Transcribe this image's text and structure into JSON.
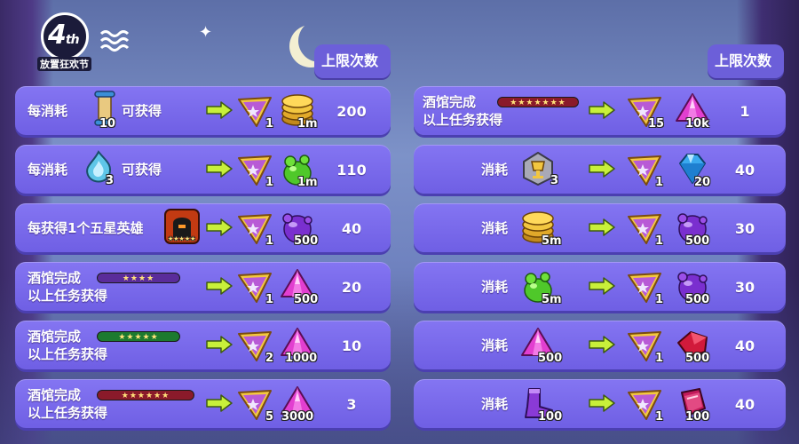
{
  "logo": {
    "main": "4",
    "sup": "th",
    "sub": "放置狂欢节"
  },
  "headers": {
    "left": "上限次数",
    "right": "上限次数"
  },
  "colors": {
    "row_bg": "#7a6aee",
    "header_bg": "#6c5fd9",
    "arrow": "#c8f03a",
    "coin": "#f2c640",
    "gem_pink": "#e23fd0",
    "potion_green": "#52d22a",
    "orb_purple": "#7a2fcf"
  },
  "left_rows": [
    {
      "line1": "每消耗",
      "after": "可获得",
      "cost_icon": "scroll-icon",
      "cost_qty": "10",
      "r1_icon": "ticket-icon",
      "r1_qty": "1",
      "r2_icon": "gold-coin-icon",
      "r2_qty": "1m",
      "limit": "200"
    },
    {
      "line1": "每消耗",
      "after": "可获得",
      "cost_icon": "spirit-flame-icon",
      "cost_qty": "3",
      "r1_icon": "ticket-icon",
      "r1_qty": "1",
      "r2_icon": "green-potion-icon",
      "r2_qty": "1m",
      "limit": "110"
    },
    {
      "line1": "每获得1个五星英雄",
      "cost_icon": "hero-card-icon",
      "cost_qty": "★★★★★",
      "r1_icon": "ticket-icon",
      "r1_qty": "1",
      "r2_icon": "purple-orb-icon",
      "r2_qty": "500",
      "limit": "40"
    },
    {
      "line1": "酒馆完成",
      "line2": "以上任务获得",
      "stars": "★★★★",
      "bar": "purple",
      "r1_icon": "ticket-icon",
      "r1_qty": "1",
      "r2_icon": "pink-gem-icon",
      "r2_qty": "500",
      "limit": "20"
    },
    {
      "line1": "酒馆完成",
      "line2": "以上任务获得",
      "stars": "★★★★★",
      "bar": "green",
      "r1_icon": "ticket-icon",
      "r1_qty": "2",
      "r2_icon": "pink-gem-icon",
      "r2_qty": "1000",
      "limit": "10"
    },
    {
      "line1": "酒馆完成",
      "line2": "以上任务获得",
      "stars": "★★★★★★",
      "bar": "red",
      "r1_icon": "ticket-icon",
      "r1_qty": "5",
      "r2_icon": "pink-gem-icon",
      "r2_qty": "3000",
      "limit": "3"
    }
  ],
  "right_rows": [
    {
      "line1": "酒馆完成",
      "line2": "以上任务获得",
      "stars": "★★★★★★★",
      "bar": "red",
      "r1_icon": "ticket-icon",
      "r1_qty": "15",
      "r2_icon": "pink-gem-icon",
      "r2_qty": "10k",
      "limit": "1"
    },
    {
      "label": "消耗",
      "cost_icon": "gold-trophy-card-icon",
      "cost_qty": "3",
      "r1_icon": "ticket-icon",
      "r1_qty": "1",
      "r2_icon": "blue-diamond-icon",
      "r2_qty": "20",
      "limit": "40"
    },
    {
      "label": "消耗",
      "cost_icon": "gold-coin-icon",
      "cost_qty": "5m",
      "r1_icon": "ticket-icon",
      "r1_qty": "1",
      "r2_icon": "purple-orb-icon",
      "r2_qty": "500",
      "limit": "30"
    },
    {
      "label": "消耗",
      "cost_icon": "green-potion-icon",
      "cost_qty": "5m",
      "r1_icon": "ticket-icon",
      "r1_qty": "1",
      "r2_icon": "purple-orb-icon",
      "r2_qty": "500",
      "limit": "30"
    },
    {
      "label": "消耗",
      "cost_icon": "pink-gem-icon",
      "cost_qty": "500",
      "r1_icon": "ticket-icon",
      "r1_qty": "1",
      "r2_icon": "red-crystal-icon",
      "r2_qty": "500",
      "limit": "40"
    },
    {
      "label": "消耗",
      "cost_icon": "purple-boot-icon",
      "cost_qty": "100",
      "r1_icon": "ticket-icon",
      "r1_qty": "1",
      "r2_icon": "red-gem-icon",
      "r2_qty": "100",
      "limit": "40"
    }
  ]
}
